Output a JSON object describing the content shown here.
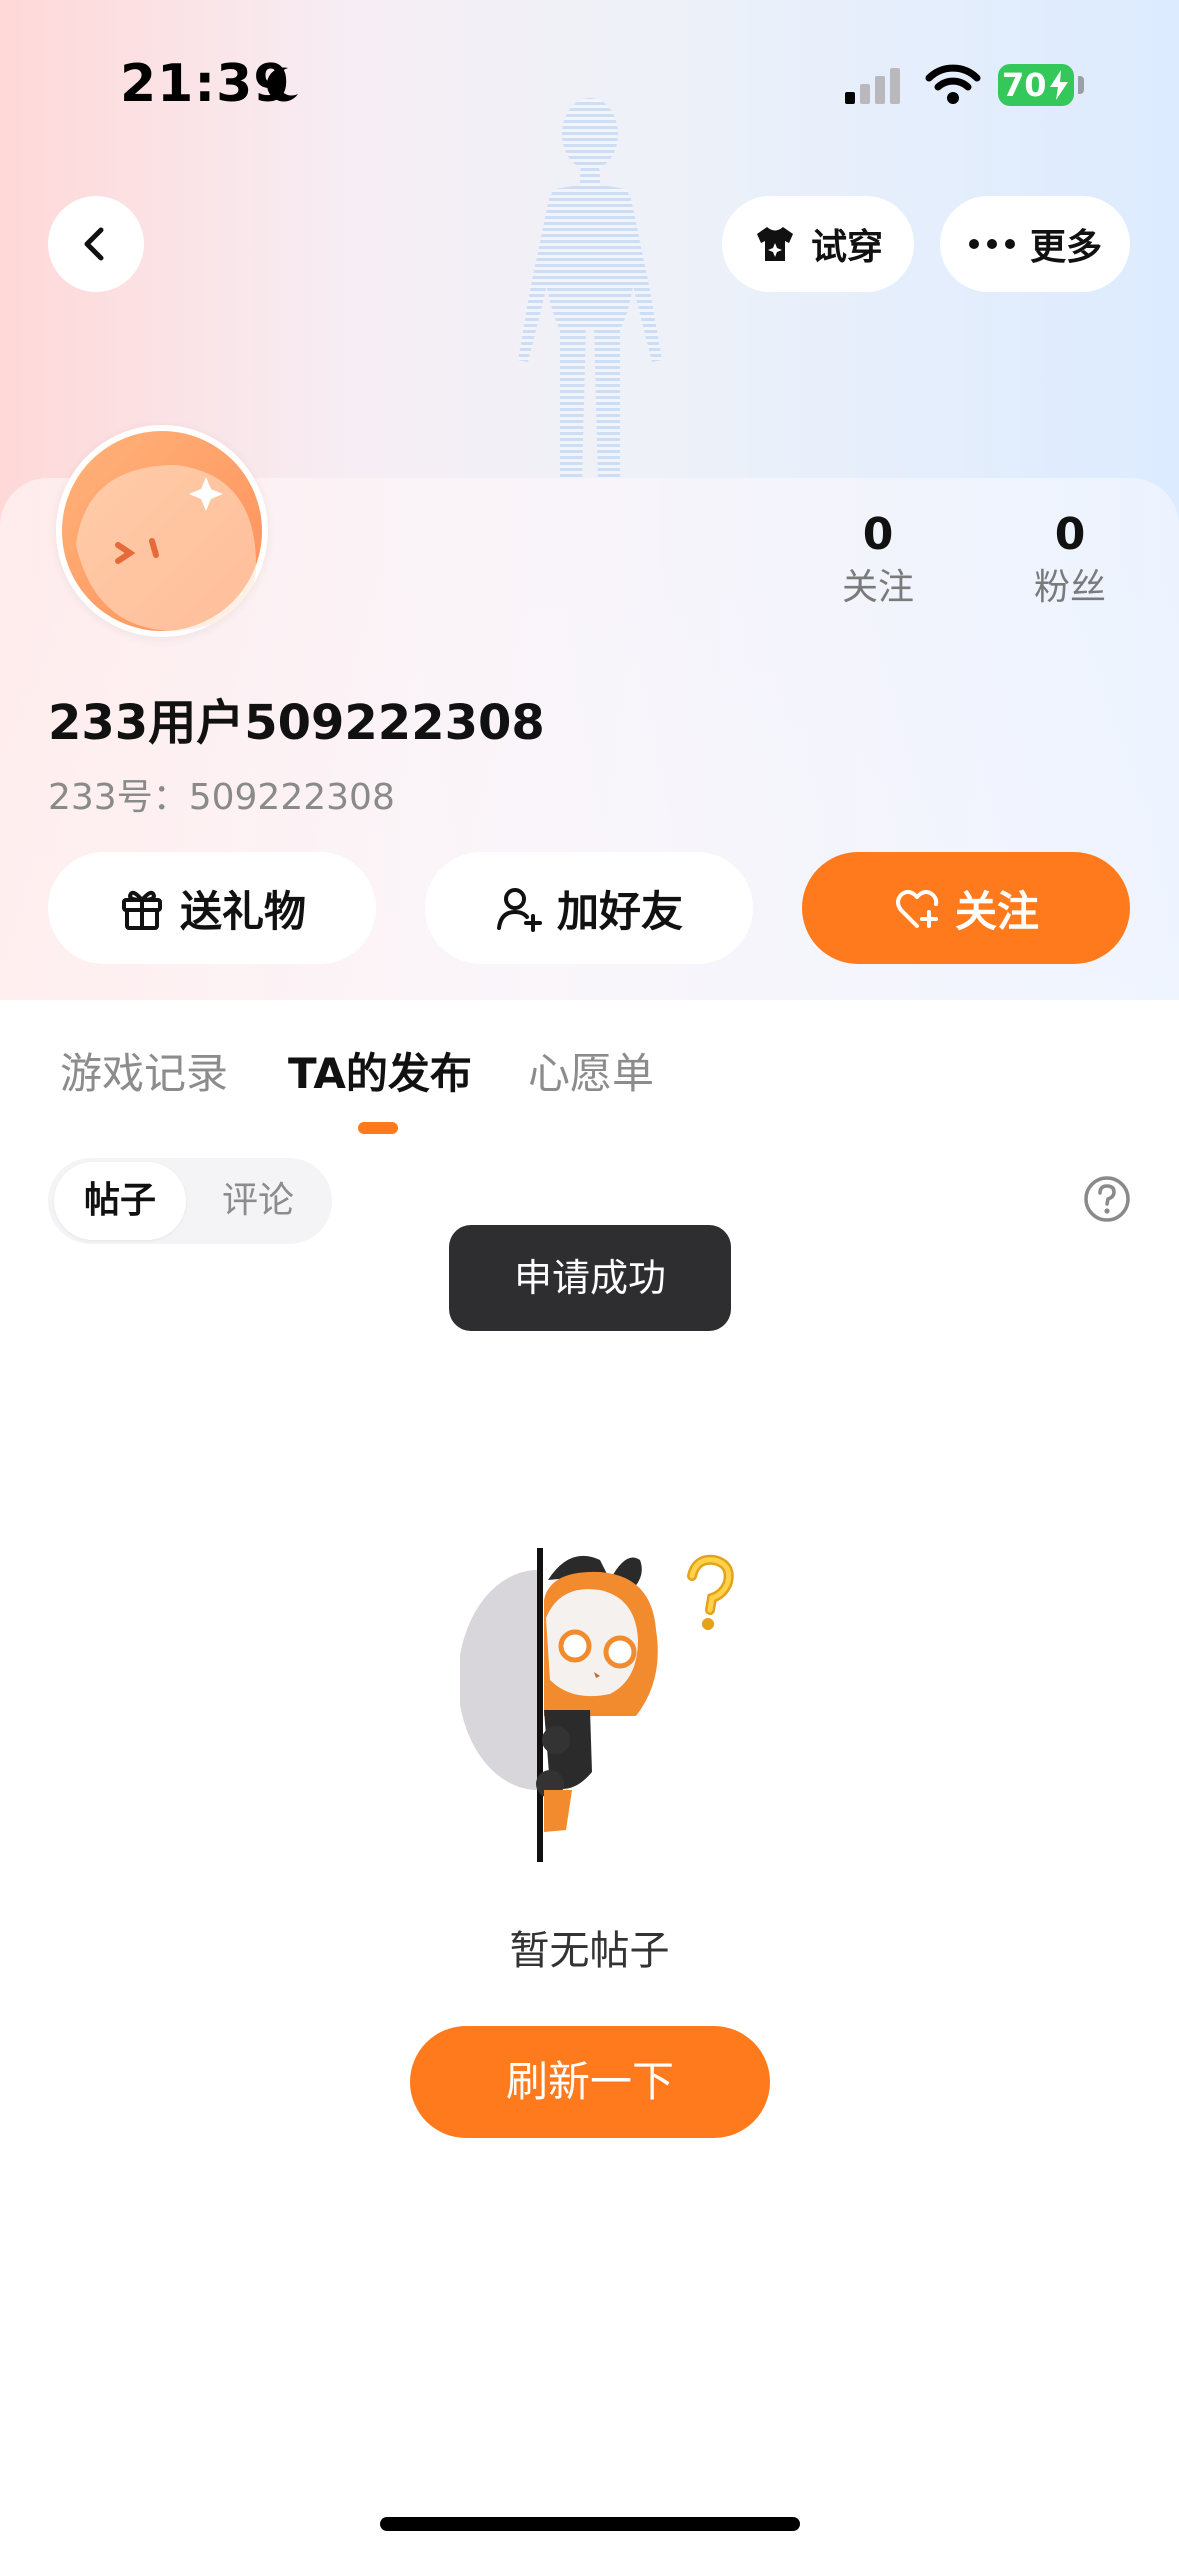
{
  "status_bar": {
    "time": "21:39",
    "battery": "70"
  },
  "header": {
    "tryon_label": "试穿",
    "more_label": "更多"
  },
  "profile": {
    "username": "233用户509222308",
    "user_id": "233号：509222308",
    "following_count": "0",
    "following_label": "关注",
    "fans_count": "0",
    "fans_label": "粉丝"
  },
  "actions": {
    "gift_label": "送礼物",
    "add_friend_label": "加好友",
    "follow_label": "关注"
  },
  "tabs": [
    {
      "label": "游戏记录",
      "active": false
    },
    {
      "label": "TA的发布",
      "active": true
    },
    {
      "label": "心愿单",
      "active": false
    }
  ],
  "segment": {
    "posts_label": "帖子",
    "comments_label": "评论",
    "selected": "帖子"
  },
  "toast": {
    "text": "申请成功"
  },
  "empty_state": {
    "text": "暂无帖子",
    "refresh_label": "刷新一下"
  },
  "colors": {
    "accent": "#ff7a1c",
    "toast_bg": "#2e2e30",
    "battery": "#34c759"
  }
}
